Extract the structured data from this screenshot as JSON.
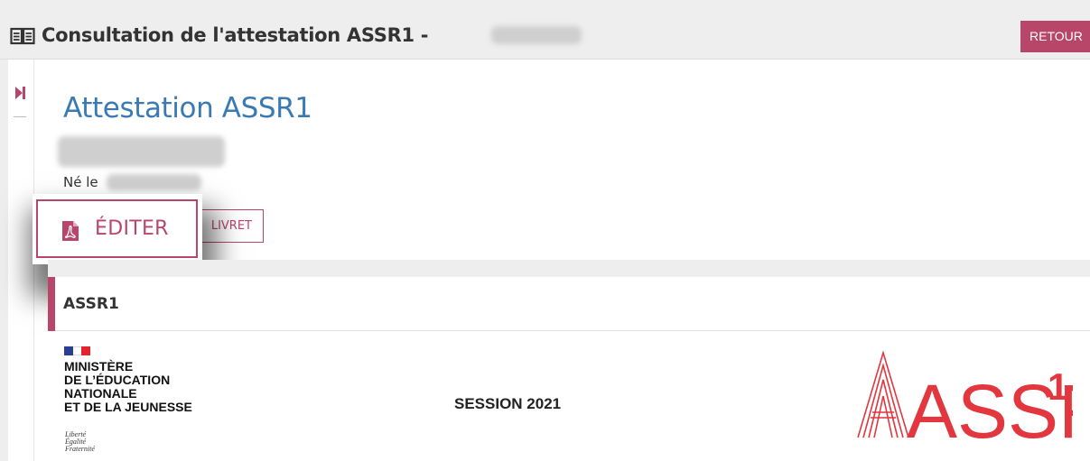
{
  "header": {
    "title": "Consultation de l'attestation ASSR1 - ",
    "book_icon": "book-open-icon",
    "retour_label": "RETOUR"
  },
  "sidebar": {
    "toggle_icon": "sidebar-expand-icon"
  },
  "card": {
    "title": "Attestation ASSR1",
    "born_label": "Né le",
    "editer_label": "ÉDITER",
    "editer_icon": "pdf-file-icon",
    "livret_label": "LIVRET"
  },
  "section": {
    "title": "ASSR1"
  },
  "document": {
    "ministry_lines": [
      "MINISTÈRE",
      "DE L’ÉDUCATION",
      "NATIONALE",
      "ET DE LA JEUNESSE"
    ],
    "motto_lines": [
      "Liberté",
      "Égalité",
      "Fraternité"
    ],
    "session": "SESSION 2021",
    "logo_text": "ASSR",
    "logo_superscript": "1"
  },
  "colors": {
    "accent": "#b8466b",
    "title_blue": "#3a7ab4",
    "logo_red": "#e2373e",
    "header_bg": "#eeeeee"
  }
}
